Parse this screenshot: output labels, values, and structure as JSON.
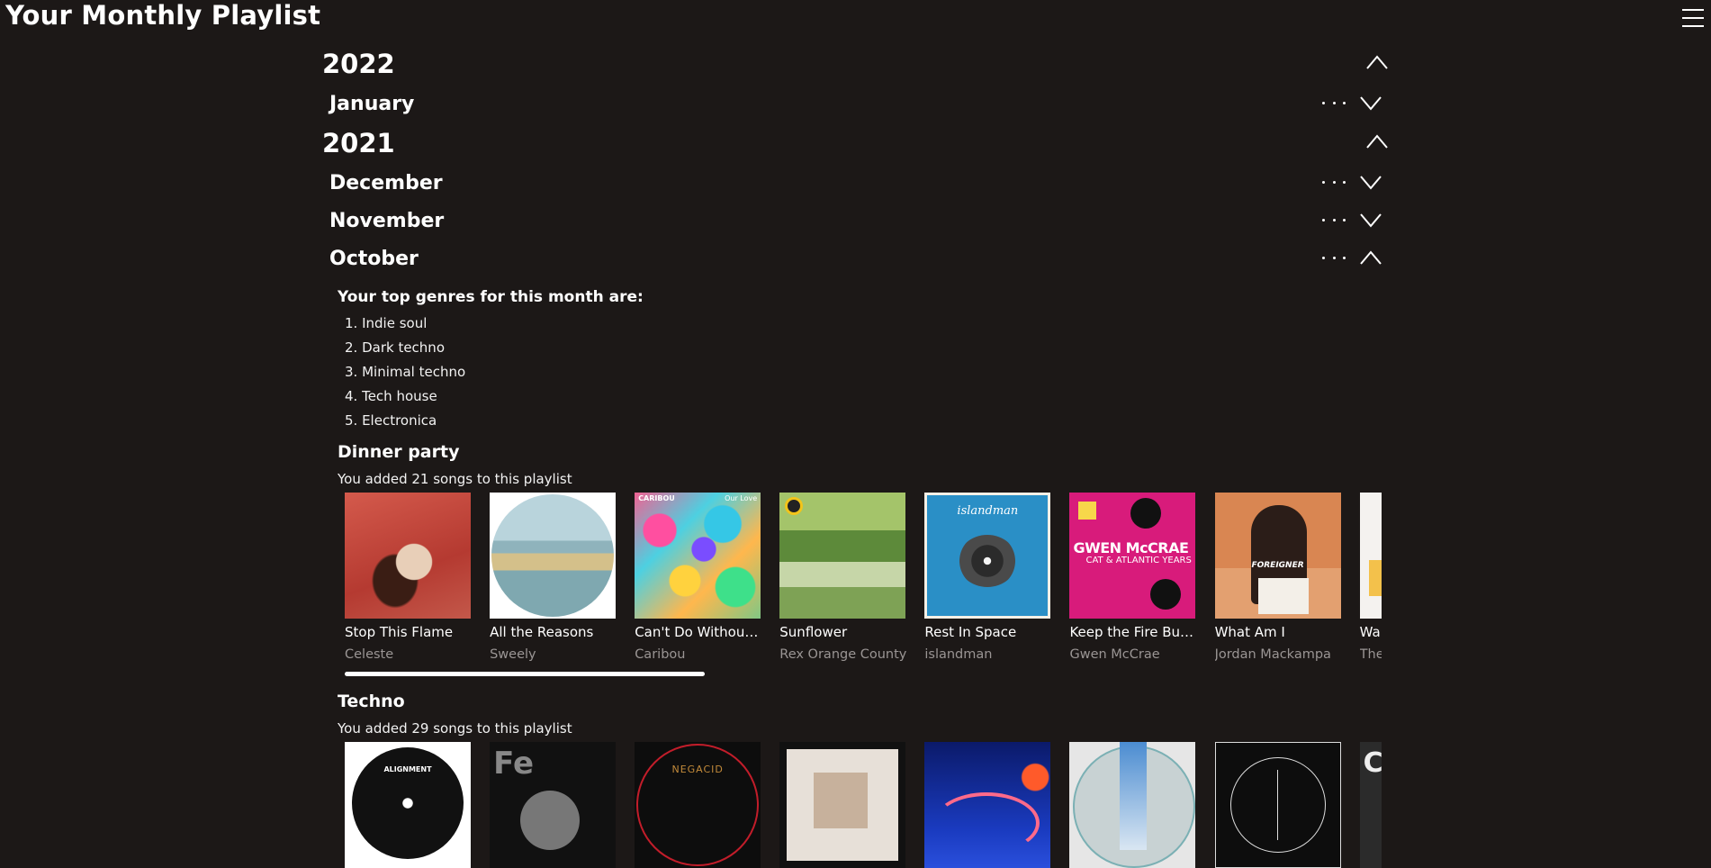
{
  "app": {
    "title": "Your Monthly Playlist"
  },
  "years": [
    {
      "year": "2022",
      "months": [
        {
          "name": "January"
        }
      ]
    },
    {
      "year": "2021",
      "months": [
        {
          "name": "December"
        },
        {
          "name": "November"
        },
        {
          "name": "October"
        }
      ]
    }
  ],
  "october": {
    "genres_heading": "Your top genres for this month are:",
    "genres": [
      "1. Indie soul",
      "2. Dark techno",
      "3. Minimal techno",
      "4. Tech house",
      "5. Electronica"
    ],
    "playlists": [
      {
        "name": "Dinner party",
        "meta": "You added 21 songs to this playlist",
        "scroll_fraction": 0.35,
        "tracks": [
          {
            "title": "Stop This Flame",
            "artist": "Celeste"
          },
          {
            "title": "All the Reasons",
            "artist": "Sweely"
          },
          {
            "title": "Can't Do Without ...",
            "artist": "Caribou"
          },
          {
            "title": "Sunflower",
            "artist": "Rex Orange County"
          },
          {
            "title": "Rest In Space",
            "artist": "islandman"
          },
          {
            "title": "Keep the Fire Bur...",
            "artist": "Gwen McCrae"
          },
          {
            "title": "What Am I",
            "artist": "Jordan Mackampa"
          },
          {
            "title": "Wanna",
            "artist": "The Inte"
          }
        ]
      },
      {
        "name": "Techno",
        "meta": "You added 29 songs to this playlist"
      }
    ]
  },
  "cover_text": {
    "caribou": "CARIBOU",
    "caribou_right": "Our Love",
    "islandman": "islandman",
    "gwen_name": "GWEN McCRAE",
    "gwen_sub": "CAT & ATLANTIC YEARS",
    "foreigner": "FOREIGNER",
    "alignment": "ALIGNMENT",
    "fe": "Fe",
    "negacid": "NEGACID",
    "ce": "CE"
  },
  "colors": {
    "background": "#1c1817",
    "text": "#ffffff",
    "muted": "#9a9594"
  }
}
